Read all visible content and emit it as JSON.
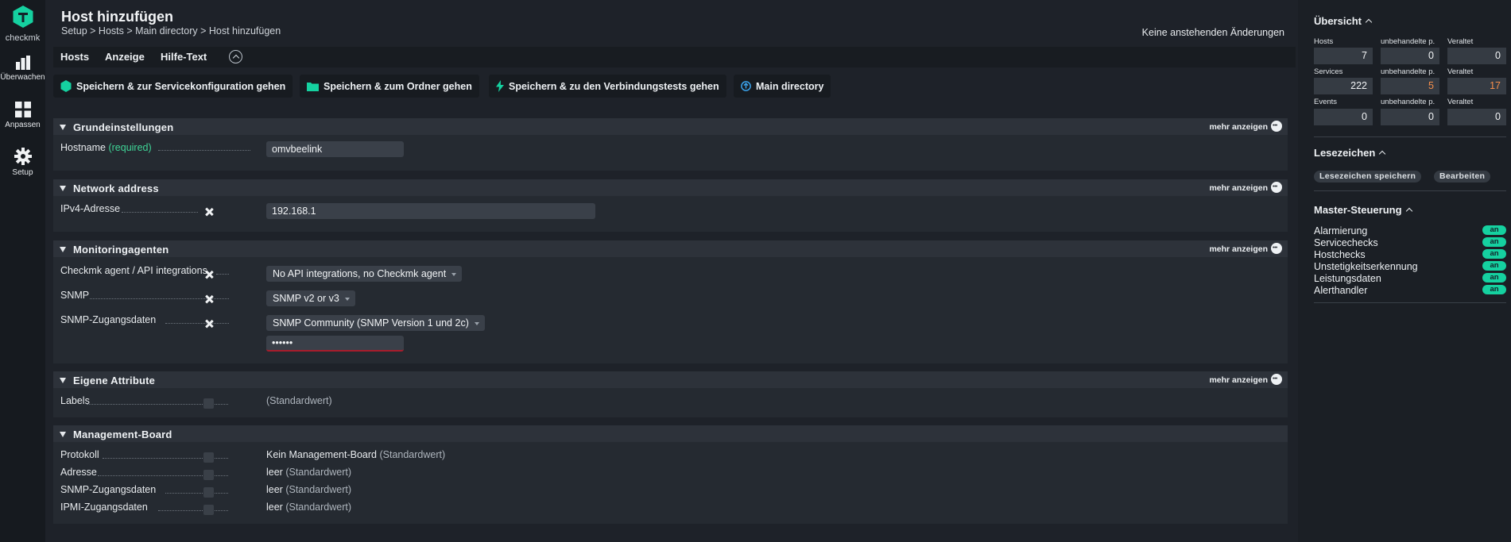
{
  "nav": {
    "logo_text": "checkmk",
    "items": [
      {
        "label": "Überwachen",
        "icon": "bar-chart-icon"
      },
      {
        "label": "Anpassen",
        "icon": "grid-icon"
      },
      {
        "label": "Setup",
        "icon": "gear-icon"
      }
    ]
  },
  "header": {
    "title": "Host hinzufügen",
    "breadcrumb": "Setup > Hosts > Main directory > Host hinzufügen",
    "pending": "Keine anstehenden Änderungen"
  },
  "menubar": {
    "items": [
      "Hosts",
      "Anzeige",
      "Hilfe-Text"
    ]
  },
  "actions": {
    "save_service": "Speichern & zur Servicekonfiguration gehen",
    "save_folder": "Speichern & zum Ordner gehen",
    "save_tests": "Speichern & zu den Verbindungstests gehen",
    "main_directory": "Main directory"
  },
  "more_label": "mehr anzeigen",
  "sections": {
    "basic": {
      "title": "Grundeinstellungen",
      "hostname_label": "Hostname",
      "required": "(required)",
      "hostname_value": "omvbeelink"
    },
    "network": {
      "title": "Network address",
      "ipv4_label": "IPv4-Adresse",
      "ipv4_value": "192.168.1"
    },
    "monitoring": {
      "title": "Monitoringagenten",
      "agent_label": "Checkmk agent / API integrations",
      "agent_value": "No API integrations, no Checkmk agent",
      "snmp_label": "SNMP",
      "snmp_value": "SNMP v2 or v3",
      "cred_label": "SNMP-Zugangsdaten",
      "cred_value": "SNMP Community (SNMP Version 1 und 2c)",
      "community_value": "••••••"
    },
    "custom": {
      "title": "Eigene Attribute",
      "labels_label": "Labels",
      "labels_value": "(Standardwert)"
    },
    "mgmt": {
      "title": "Management-Board",
      "protocol_label": "Protokoll",
      "protocol_value": "Kein Management-Board",
      "address_label": "Adresse",
      "snmp_label": "SNMP-Zugangsdaten",
      "ipmi_label": "IPMI-Zugangsdaten",
      "empty_value": "leer",
      "default_suffix": "(Standardwert)"
    }
  },
  "sidebar": {
    "overview": {
      "title": "Übersicht",
      "rows": [
        {
          "label": "Hosts",
          "unhandled_label": "unbehandelte p.",
          "stale_label": "Veraltet",
          "total": "7",
          "unhandled": "0",
          "stale": "0"
        },
        {
          "label": "Services",
          "unhandled_label": "unbehandelte p.",
          "stale_label": "Veraltet",
          "total": "222",
          "unhandled": "5",
          "stale": "17"
        },
        {
          "label": "Events",
          "unhandled_label": "unbehandelte p.",
          "stale_label": "Veraltet",
          "total": "0",
          "unhandled": "0",
          "stale": "0"
        }
      ]
    },
    "bookmarks": {
      "title": "Lesezeichen",
      "save": "Lesezeichen speichern",
      "edit": "Bearbeiten"
    },
    "master": {
      "title": "Master-Steuerung",
      "items": [
        {
          "label": "Alarmierung",
          "state": "an"
        },
        {
          "label": "Servicechecks",
          "state": "an"
        },
        {
          "label": "Hostchecks",
          "state": "an"
        },
        {
          "label": "Unstetigkeitserkennung",
          "state": "an"
        },
        {
          "label": "Leistungsdaten",
          "state": "an"
        },
        {
          "label": "Alerthandler",
          "state": "an"
        }
      ]
    }
  },
  "colors": {
    "accent": "#15d1a0",
    "warning": "#f58e4b",
    "required": "#3fd597"
  }
}
